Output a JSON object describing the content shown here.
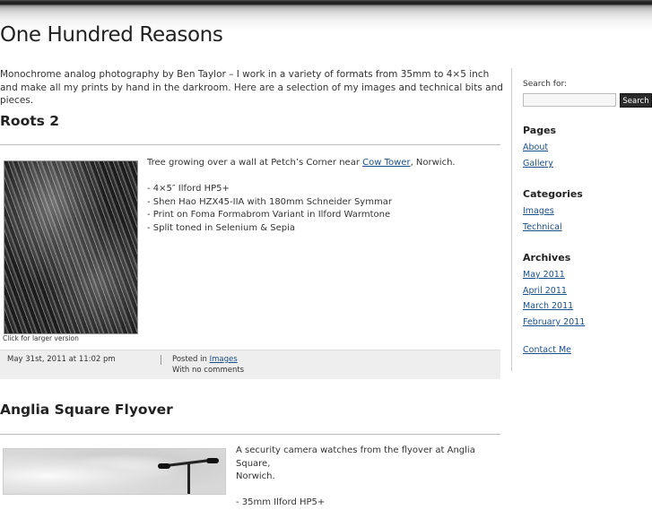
{
  "site": {
    "title": "One Hundred Reasons",
    "tagline": "Monochrome analog photography by Ben Taylor – I work in a variety of formats from 35mm to 4×5 inch and make all my prints by hand in the darkroom. Here are a selection of my images and technical bits and pieces."
  },
  "posts": [
    {
      "title": "Roots 2",
      "intro_before": "Tree growing over a wall at Petch’s Corner near ",
      "intro_link": "Cow Tower",
      "intro_after": ", Norwich.",
      "details": [
        "- 4×5″ Ilford HP5+",
        "- Shen Hao HZX45-IIA with 180mm Schneider Symmar",
        "- Print on Foma Formabrom Variant in Ilford Warmtone",
        "- Split toned in Selenium & Sepia"
      ],
      "caption": "Click for larger version",
      "date": "May 31st, 2011 at 11:02 pm",
      "posted_in_label": "Posted in",
      "category": "Images",
      "comments": "With no comments"
    },
    {
      "title": "Anglia Square Flyover",
      "intro_line1": "A security camera watches from the flyover at Anglia Square,",
      "intro_line2": "Norwich.",
      "detail_partial": "- 35mm Ilford HP5+"
    }
  ],
  "sidebar": {
    "search_label": "Search for:",
    "search_button": "Search",
    "pages_heading": "Pages",
    "pages": [
      "About",
      "Gallery"
    ],
    "categories_heading": "Categories",
    "categories": [
      "Images",
      "Technical"
    ],
    "archives_heading": "Archives",
    "archives": [
      "May 2011",
      "April 2011",
      "March 2011",
      "February 2011"
    ],
    "contact": "Contact Me"
  }
}
